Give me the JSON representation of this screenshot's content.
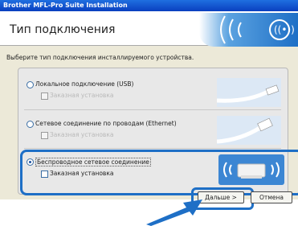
{
  "window": {
    "title": "Brother MFL-Pro Suite Installation"
  },
  "header": {
    "title": "Тип подключения",
    "logo_icon": "wireless-icon"
  },
  "prompt": "Выберите тип подключения инсталлируемого устройства.",
  "options": [
    {
      "label": "Локальное подключение (USB)",
      "custom_label": "Заказная установка",
      "selected": false,
      "custom_enabled": false
    },
    {
      "label": "Сетевое соединение по проводам (Ethernet)",
      "custom_label": "Заказная установка",
      "selected": false,
      "custom_enabled": false
    },
    {
      "label": "Беспроводное сетевое соединение",
      "custom_label": "Заказная установка",
      "selected": true,
      "custom_enabled": true
    }
  ],
  "buttons": {
    "next": "Дальше >",
    "cancel": "Отмена"
  },
  "colors": {
    "accent": "#1e6fc6",
    "titlebar": "#0a3fbf"
  }
}
